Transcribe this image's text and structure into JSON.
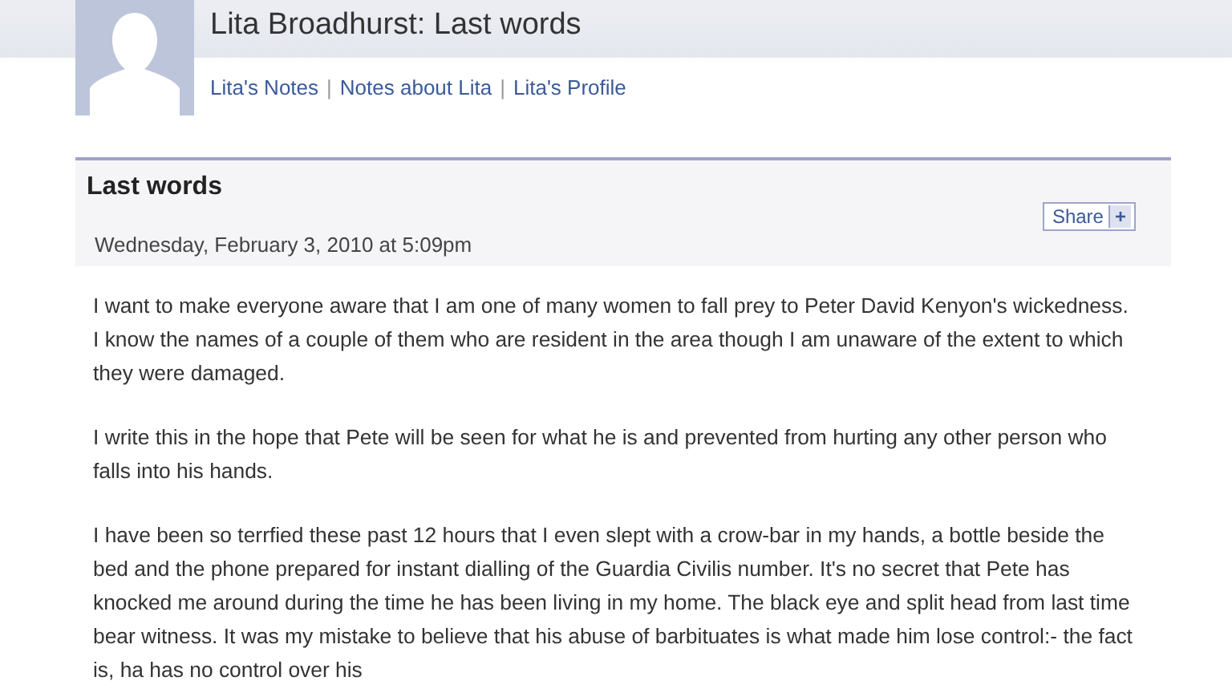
{
  "page_header": {
    "title": "Lita Broadhurst: Last words",
    "links": [
      "Lita's Notes",
      "Notes about Lita",
      "Lita's Profile"
    ],
    "separator": "|"
  },
  "note": {
    "title": "Last words",
    "share_button": {
      "label": "Share",
      "icon": "+"
    },
    "date": "Wednesday, February 3, 2010 at 5:09pm",
    "paragraphs": [
      "I want to make everyone aware that I am one of many women to fall prey to Peter David Kenyon's wickedness. I know the names of a couple of them who are resident in the area though I am unaware of the extent to which they were damaged.",
      "I write this in the hope that Pete will be seen for what he is and prevented from hurting any other person who falls into his hands.",
      "I have been so terrfied these past 12 hours that I even slept with a crow-bar in my hands, a bottle beside the bed and the phone prepared for instant dialling of the Guardia Civilis number. It's no secret that Pete has knocked me around during the time he has been living in my home. The black eye and split head from last time bear witness. It was my mistake to believe that his abuse of barbituates is what made him lose control:- the fact is, ha has no control over his"
    ]
  }
}
